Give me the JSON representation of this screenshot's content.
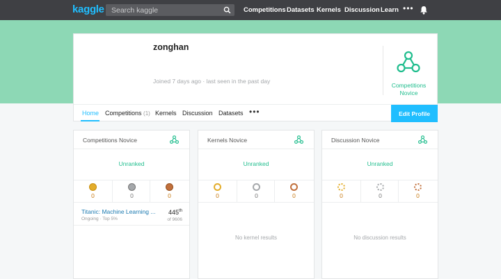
{
  "topbar": {
    "logo": "kaggle",
    "search_placeholder": "Search kaggle",
    "nav": [
      "Competitions",
      "Datasets",
      "Kernels",
      "Discussion",
      "Learn"
    ],
    "more": "•••"
  },
  "profile": {
    "username": "zonghan",
    "joined": "Joined 7 days ago · last seen in the past day",
    "tier_line1": "Competitions",
    "tier_line2": "Novice",
    "accent": "#20beff",
    "hero_color": "#8dd8b5"
  },
  "tabs": {
    "home": "Home",
    "competitions": "Competitions",
    "competitions_count": "(1)",
    "kernels": "Kernels",
    "discussion": "Discussion",
    "datasets": "Datasets",
    "more": "•••",
    "edit": "Edit Profile"
  },
  "panels": [
    {
      "title": "Competitions Novice",
      "rank": "Unranked",
      "medals": [
        "0",
        "0",
        "0"
      ],
      "entry": {
        "title": "Titanic: Machine Learning ...",
        "sub": "Ongoing · Top 5%",
        "rank": "445",
        "rank_suffix": "th",
        "of": "of 9606"
      }
    },
    {
      "title": "Kernels Novice",
      "rank": "Unranked",
      "medals": [
        "0",
        "0",
        "0"
      ],
      "empty": "No kernel results"
    },
    {
      "title": "Discussion Novice",
      "rank": "Unranked",
      "medals": [
        "0",
        "0",
        "0"
      ],
      "empty": "No discussion results"
    }
  ]
}
